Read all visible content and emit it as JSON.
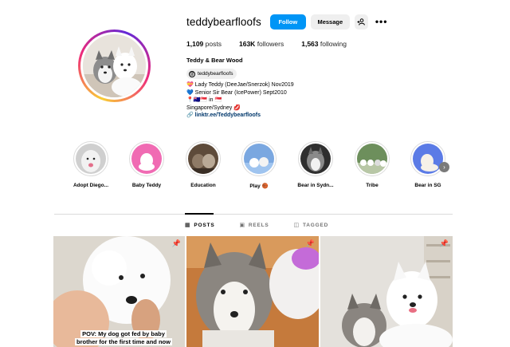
{
  "profile": {
    "username": "teddybearfloofs",
    "follow_label": "Follow",
    "message_label": "Message",
    "add_user_icon": "add-user-icon",
    "more_icon": "more-options-icon",
    "more_glyph": "•••",
    "posts_count": "1,109",
    "posts_label": "posts",
    "followers_count": "163K",
    "followers_label": "followers",
    "following_count": "1,563",
    "following_label": "following",
    "full_name": "Teddy & Bear Wood",
    "threads_handle": "teddybearfloofs",
    "bio_lines": [
      "💝 Lady Teddy (DeeJae/Snerzok) Nov2019",
      "💙 Senior Sir Bear (IcePower) Sept2010",
      "📍🇦🇺🇸🇬 in 🇸🇬",
      "Singapore/Sydney 💋"
    ],
    "link_text": "linktr.ee/Teddybearfloofs"
  },
  "highlights": [
    {
      "label": "Adopt Diego..."
    },
    {
      "label": "Baby Teddy"
    },
    {
      "label": "Education"
    },
    {
      "label": "Play 🏀"
    },
    {
      "label": "Bear in Sydn..."
    },
    {
      "label": "Tribe"
    },
    {
      "label": "Bear in SG"
    }
  ],
  "tabs": [
    {
      "label": "POSTS",
      "icon": "grid-icon",
      "glyph": "▦"
    },
    {
      "label": "REELS",
      "icon": "reels-icon",
      "glyph": "▣"
    },
    {
      "label": "TAGGED",
      "icon": "tagged-icon",
      "glyph": "◫"
    }
  ],
  "posts": [
    {
      "caption": "POV: My dog got fed by baby brother for the first time and now",
      "pinned": true
    },
    {
      "caption": "",
      "pinned": true
    },
    {
      "caption": "",
      "pinned": true
    }
  ],
  "colors": {
    "accent": "#0095f6",
    "link": "#00376b",
    "border": "#dbdbdb",
    "button_gray": "#efefef"
  }
}
